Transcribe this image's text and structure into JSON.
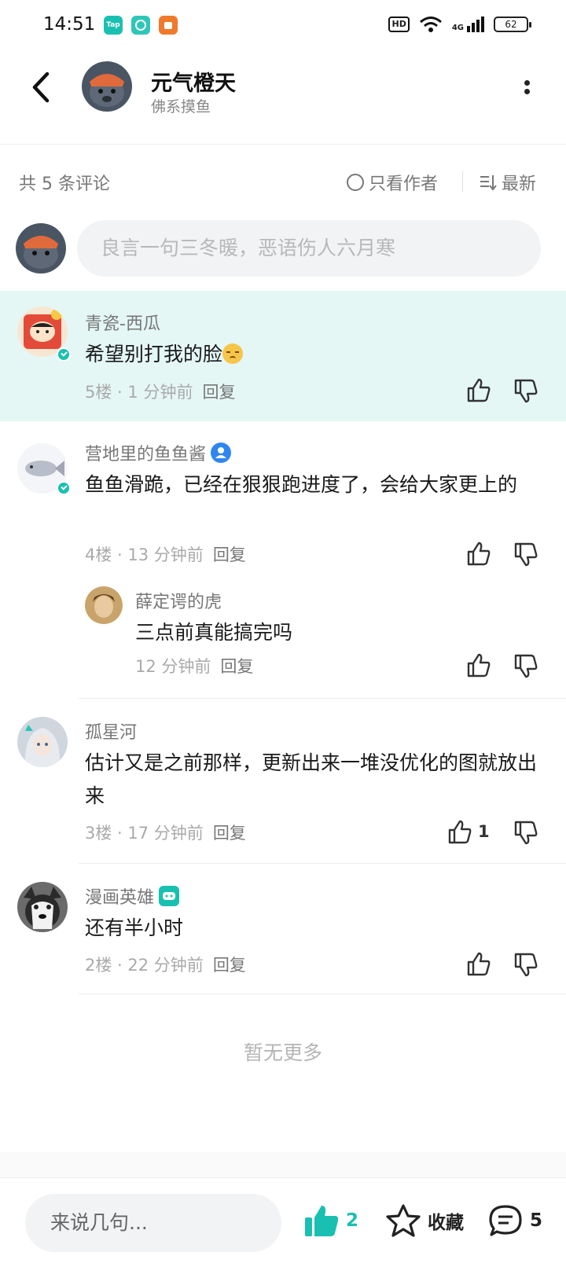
{
  "status_bar": {
    "time": "14:51",
    "apps": [
      {
        "name": "Tap",
        "color": "#19c0b1"
      },
      {
        "name": "",
        "color": "#2ec6b7"
      },
      {
        "name": "",
        "color": "#f07a2c"
      }
    ],
    "hd": "HD",
    "network": "4G",
    "battery": "62"
  },
  "header": {
    "name": "元气橙天",
    "subtitle": "佛系摸鱼"
  },
  "filter": {
    "count": "共 5 条评论",
    "author_only": "只看作者",
    "sort": "最新"
  },
  "composer": {
    "placeholder": "良言一句三冬暖，恶语伤人六月寒"
  },
  "comments": [
    {
      "user": "青瓷-西瓜",
      "text": "希望别打我的脸",
      "floor": "5楼",
      "time": "1 分钟前",
      "reply": "回复",
      "highlight": true
    },
    {
      "user": "营地里的鱼鱼酱",
      "text": "鱼鱼滑跪，已经在狠狠跑进度了，会给大家更上的",
      "floor": "4楼",
      "time": "13 分钟前",
      "reply": "回复",
      "sub": {
        "user": "薛定谔的虎",
        "text": "三点前真能搞完吗",
        "time": "12 分钟前",
        "reply": "回复"
      }
    },
    {
      "user": "孤星河",
      "text": "估计又是之前那样，更新出来一堆没优化的图就放出来",
      "floor": "3楼",
      "time": "17 分钟前",
      "reply": "回复",
      "likes": "1"
    },
    {
      "user": "漫画英雄",
      "text": "还有半小时",
      "floor": "2楼",
      "time": "22 分钟前",
      "reply": "回复"
    }
  ],
  "no_more": "暂无更多",
  "bottom_bar": {
    "input_placeholder": "来说几句...",
    "like_count": "2",
    "favorite_label": "收藏",
    "comment_count": "5"
  },
  "colors": {
    "accent": "#19c0b1",
    "highlight_bg": "#e4f7f5"
  }
}
